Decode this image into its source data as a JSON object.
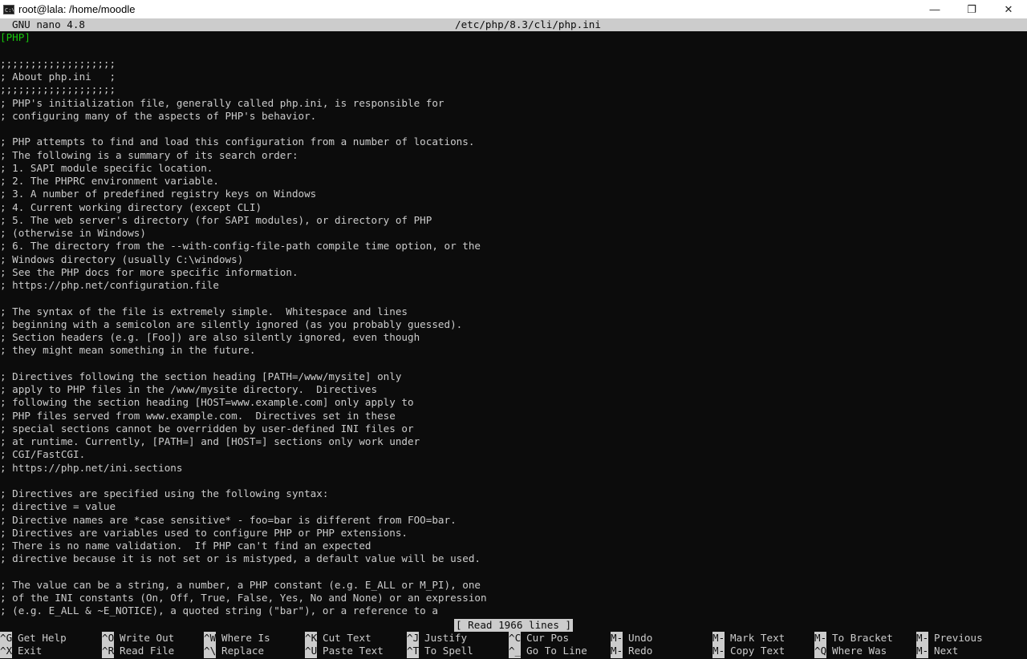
{
  "window": {
    "title": "root@lala: /home/moodle",
    "minimize": "—",
    "restore": "❐",
    "close": "✕"
  },
  "nano": {
    "version": "GNU nano 4.8",
    "filename": "/etc/php/8.3/cli/php.ini",
    "status": "[ Read 1966 lines ]"
  },
  "content": {
    "section": "[PHP]",
    "lines": [
      "",
      ";;;;;;;;;;;;;;;;;;;",
      "; About php.ini   ;",
      ";;;;;;;;;;;;;;;;;;;",
      "; PHP's initialization file, generally called php.ini, is responsible for",
      "; configuring many of the aspects of PHP's behavior.",
      "",
      "; PHP attempts to find and load this configuration from a number of locations.",
      "; The following is a summary of its search order:",
      "; 1. SAPI module specific location.",
      "; 2. The PHPRC environment variable.",
      "; 3. A number of predefined registry keys on Windows",
      "; 4. Current working directory (except CLI)",
      "; 5. The web server's directory (for SAPI modules), or directory of PHP",
      "; (otherwise in Windows)",
      "; 6. The directory from the --with-config-file-path compile time option, or the",
      "; Windows directory (usually C:\\windows)",
      "; See the PHP docs for more specific information.",
      "; https://php.net/configuration.file",
      "",
      "; The syntax of the file is extremely simple.  Whitespace and lines",
      "; beginning with a semicolon are silently ignored (as you probably guessed).",
      "; Section headers (e.g. [Foo]) are also silently ignored, even though",
      "; they might mean something in the future.",
      "",
      "; Directives following the section heading [PATH=/www/mysite] only",
      "; apply to PHP files in the /www/mysite directory.  Directives",
      "; following the section heading [HOST=www.example.com] only apply to",
      "; PHP files served from www.example.com.  Directives set in these",
      "; special sections cannot be overridden by user-defined INI files or",
      "; at runtime. Currently, [PATH=] and [HOST=] sections only work under",
      "; CGI/FastCGI.",
      "; https://php.net/ini.sections",
      "",
      "; Directives are specified using the following syntax:",
      "; directive = value",
      "; Directive names are *case sensitive* - foo=bar is different from FOO=bar.",
      "; Directives are variables used to configure PHP or PHP extensions.",
      "; There is no name validation.  If PHP can't find an expected",
      "; directive because it is not set or is mistyped, a default value will be used.",
      "",
      "; The value can be a string, a number, a PHP constant (e.g. E_ALL or M_PI), one",
      "; of the INI constants (On, Off, True, False, Yes, No and None) or an expression",
      "; (e.g. E_ALL & ~E_NOTICE), a quoted string (\"bar\"), or a reference to a"
    ]
  },
  "shortcuts": {
    "row1": [
      {
        "key": "^G",
        "label": "Get Help"
      },
      {
        "key": "^O",
        "label": "Write Out"
      },
      {
        "key": "^W",
        "label": "Where Is"
      },
      {
        "key": "^K",
        "label": "Cut Text"
      },
      {
        "key": "^J",
        "label": "Justify"
      },
      {
        "key": "^C",
        "label": "Cur Pos"
      },
      {
        "key": "M-U",
        "label": "Undo"
      },
      {
        "key": "M-A",
        "label": "Mark Text"
      },
      {
        "key": "M-]",
        "label": "To Bracket"
      },
      {
        "key": "M-Q",
        "label": "Previous"
      }
    ],
    "row2": [
      {
        "key": "^X",
        "label": "Exit"
      },
      {
        "key": "^R",
        "label": "Read File"
      },
      {
        "key": "^\\",
        "label": "Replace"
      },
      {
        "key": "^U",
        "label": "Paste Text"
      },
      {
        "key": "^T",
        "label": "To Spell"
      },
      {
        "key": "^_",
        "label": "Go To Line"
      },
      {
        "key": "M-E",
        "label": "Redo"
      },
      {
        "key": "M-6",
        "label": "Copy Text"
      },
      {
        "key": "^Q",
        "label": "Where Was"
      },
      {
        "key": "M-W",
        "label": "Next"
      }
    ]
  }
}
